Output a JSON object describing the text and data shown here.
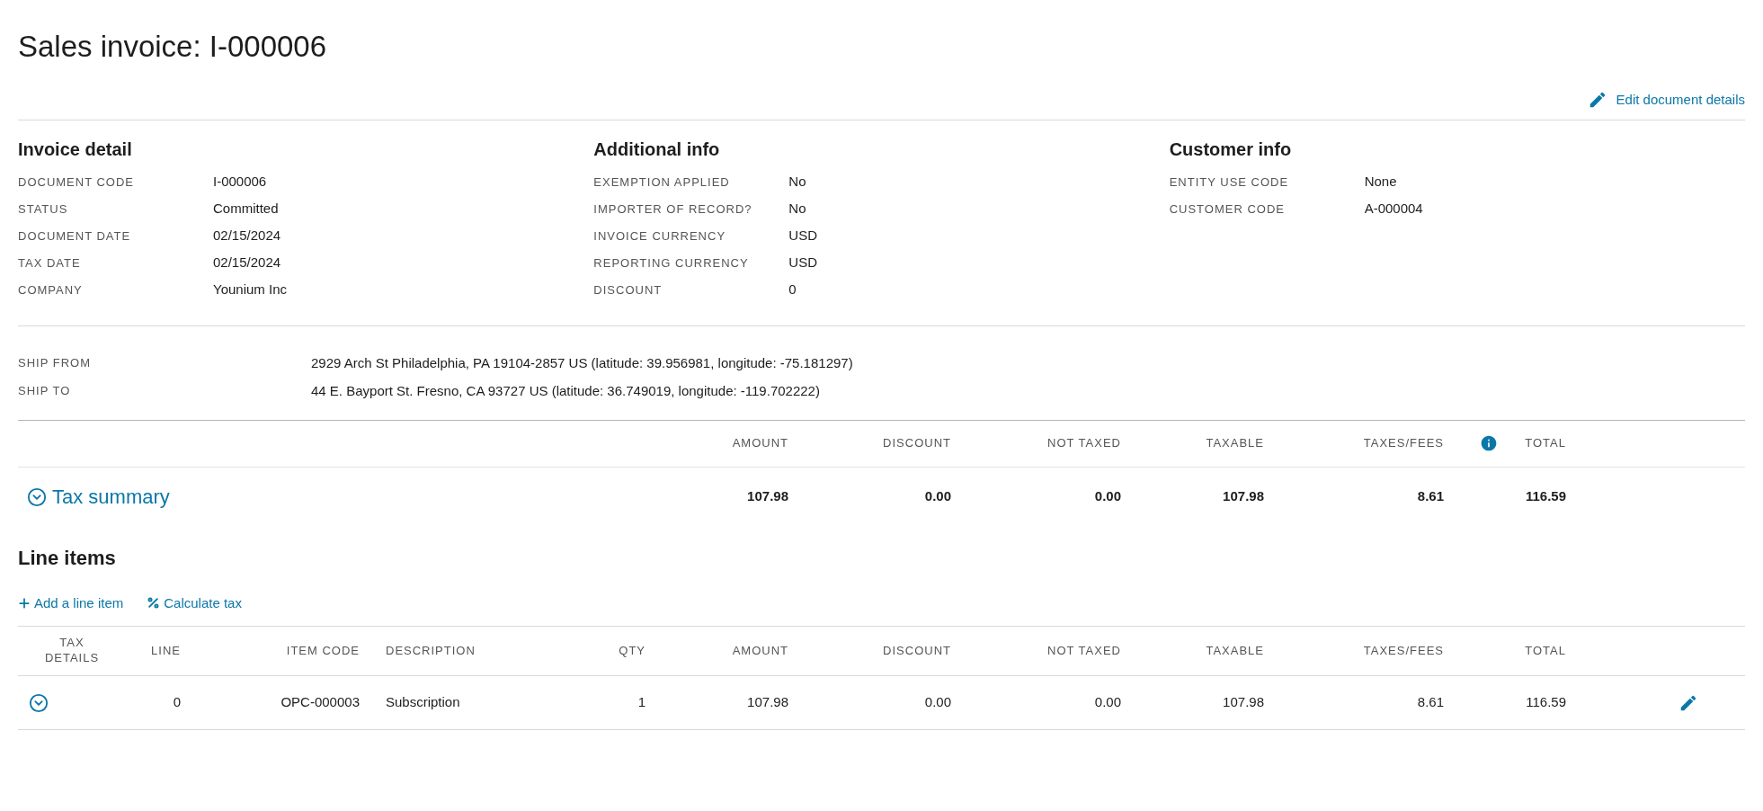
{
  "title": "Sales invoice: I-000006",
  "edit_button": {
    "label": "Edit document details"
  },
  "sections": [
    {
      "heading": "Invoice detail",
      "fields": [
        {
          "label": "DOCUMENT CODE",
          "value": "I-000006"
        },
        {
          "label": "STATUS",
          "value": "Committed"
        },
        {
          "label": "DOCUMENT DATE",
          "value": "02/15/2024"
        },
        {
          "label": "TAX DATE",
          "value": "02/15/2024"
        },
        {
          "label": "COMPANY",
          "value": "Younium Inc"
        }
      ]
    },
    {
      "heading": "Additional info",
      "fields": [
        {
          "label": "EXEMPTION APPLIED",
          "value": "No"
        },
        {
          "label": "IMPORTER OF RECORD?",
          "value": "No"
        },
        {
          "label": "INVOICE CURRENCY",
          "value": "USD"
        },
        {
          "label": "REPORTING CURRENCY",
          "value": "USD"
        },
        {
          "label": "DISCOUNT",
          "value": "0"
        }
      ]
    },
    {
      "heading": "Customer info",
      "fields": [
        {
          "label": "ENTITY USE CODE",
          "value": "None"
        },
        {
          "label": "CUSTOMER CODE",
          "value": "A-000004"
        }
      ]
    }
  ],
  "shipping": [
    {
      "label": "SHIP FROM",
      "value": "2929 Arch St Philadelphia, PA 19104-2857 US (latitude: 39.956981, longitude: -75.181297)"
    },
    {
      "label": "SHIP TO",
      "value": "44 E. Bayport St. Fresno, CA 93727 US (latitude: 36.749019, longitude: -119.702222)"
    }
  ],
  "tax_summary": {
    "title": "Tax summary",
    "columns": [
      "AMOUNT",
      "DISCOUNT",
      "NOT TAXED",
      "TAXABLE",
      "TAXES/FEES",
      "TOTAL"
    ],
    "values": [
      "107.98",
      "0.00",
      "0.00",
      "107.98",
      "8.61",
      "116.59"
    ]
  },
  "line_items": {
    "heading": "Line items",
    "actions": [
      {
        "kind": "add",
        "label": "Add a line item"
      },
      {
        "kind": "percent",
        "label": "Calculate tax"
      }
    ],
    "columns": [
      "TAX DETAILS",
      "LINE",
      "ITEM CODE",
      "DESCRIPTION",
      "QTY",
      "AMOUNT",
      "DISCOUNT",
      "NOT TAXED",
      "TAXABLE",
      "TAXES/FEES",
      "TOTAL"
    ],
    "rows": [
      {
        "cells": [
          "",
          "0",
          "OPC-000003",
          "Subscription",
          "1",
          "107.98",
          "0.00",
          "0.00",
          "107.98",
          "8.61",
          "116.59"
        ]
      }
    ]
  }
}
